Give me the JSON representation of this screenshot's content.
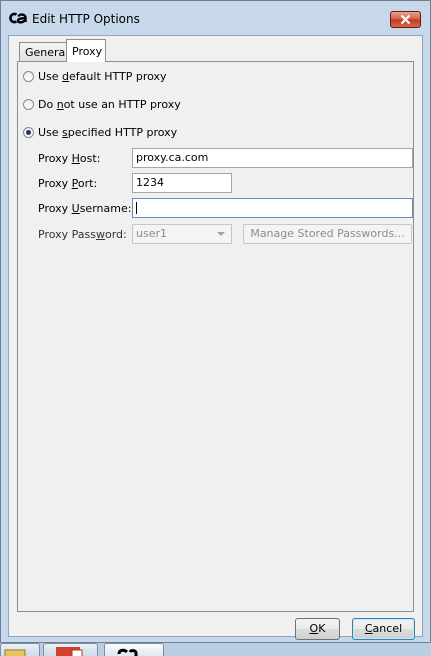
{
  "window": {
    "title": "Edit HTTP Options",
    "logo": "ca-logo",
    "close_icon": "close-icon"
  },
  "tabs": [
    {
      "label": "General",
      "active": false
    },
    {
      "label": "Proxy",
      "active": true
    }
  ],
  "proxy": {
    "options": [
      {
        "pre": "Use ",
        "mn": "d",
        "post": "efault HTTP proxy",
        "checked": false
      },
      {
        "pre": "Do ",
        "mn": "n",
        "post": "ot use an HTTP proxy",
        "checked": false
      },
      {
        "pre": "Use ",
        "mn": "s",
        "post": "pecified HTTP proxy",
        "checked": true
      }
    ],
    "host": {
      "pre": "Proxy ",
      "mn": "H",
      "post": "ost:",
      "value": "proxy.ca.com"
    },
    "port": {
      "pre": "Proxy ",
      "mn": "P",
      "post": "ort:",
      "value": "1234"
    },
    "username": {
      "pre": "Proxy ",
      "mn": "U",
      "post": "sername:",
      "value": ""
    },
    "password": {
      "pre": "Proxy Pass",
      "mn": "w",
      "post": "ord:",
      "value": "user1",
      "manage_label": "Manage Stored Passwords..."
    }
  },
  "buttons": {
    "ok": {
      "mn": "O",
      "post": "K"
    },
    "cancel": {
      "mn": "C",
      "post": "ancel"
    }
  },
  "colors": {
    "accent": "#1c3b5c",
    "close": "#c0391f",
    "frame": "#c7d8ea"
  }
}
